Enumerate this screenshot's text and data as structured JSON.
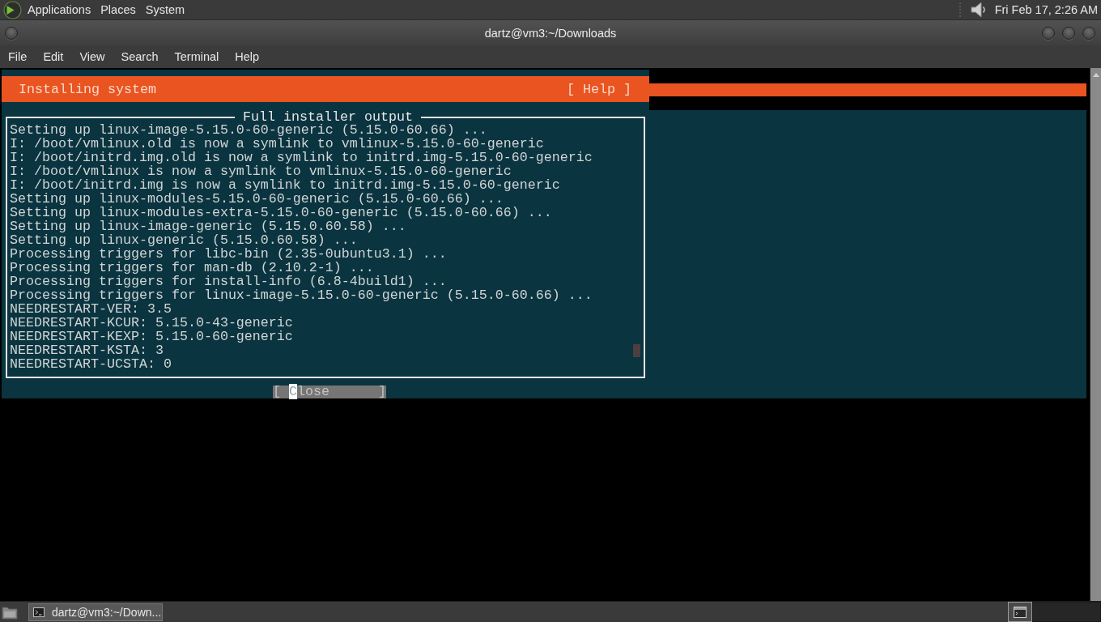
{
  "top_panel": {
    "menus": [
      "Applications",
      "Places",
      "System"
    ],
    "clock": "Fri Feb 17, 2:26 AM"
  },
  "window": {
    "title": "dartz@vm3:~/Downloads",
    "menu": [
      "File",
      "Edit",
      "View",
      "Search",
      "Terminal",
      "Help"
    ]
  },
  "installer": {
    "header": {
      "title": "Installing system",
      "help_button": "[ Help ]"
    },
    "output_box": {
      "title": "Full installer output",
      "lines": [
        "Setting up linux-image-5.15.0-60-generic (5.15.0-60.66) ...",
        "I: /boot/vmlinux.old is now a symlink to vmlinux-5.15.0-60-generic",
        "I: /boot/initrd.img.old is now a symlink to initrd.img-5.15.0-60-generic",
        "I: /boot/vmlinux is now a symlink to vmlinux-5.15.0-60-generic",
        "I: /boot/initrd.img is now a symlink to initrd.img-5.15.0-60-generic",
        "Setting up linux-modules-5.15.0-60-generic (5.15.0-60.66) ...",
        "Setting up linux-modules-extra-5.15.0-60-generic (5.15.0-60.66) ...",
        "Setting up linux-image-generic (5.15.0.60.58) ...",
        "Setting up linux-generic (5.15.0.60.58) ...",
        "Processing triggers for libc-bin (2.35-0ubuntu3.1) ...",
        "Processing triggers for man-db (2.10.2-1) ...",
        "Processing triggers for install-info (6.8-4build1) ...",
        "Processing triggers for linux-image-5.15.0-60-generic (5.15.0-60.66) ...",
        "NEEDRESTART-VER: 3.5",
        "NEEDRESTART-KCUR: 5.15.0-43-generic",
        "NEEDRESTART-KEXP: 5.15.0-60-generic",
        "NEEDRESTART-KSTA: 3",
        "NEEDRESTART-UCSTA: 0"
      ]
    },
    "close_button": {
      "open": "[",
      "label": "Close",
      "close": "]",
      "focused": true
    }
  },
  "taskbar": {
    "tasks": [
      {
        "label": "dartz@vm3:~/Down...",
        "selected": true
      }
    ],
    "workspaces": [
      {
        "selected": true,
        "has_window": true
      },
      {
        "selected": false,
        "has_window": false
      }
    ]
  }
}
